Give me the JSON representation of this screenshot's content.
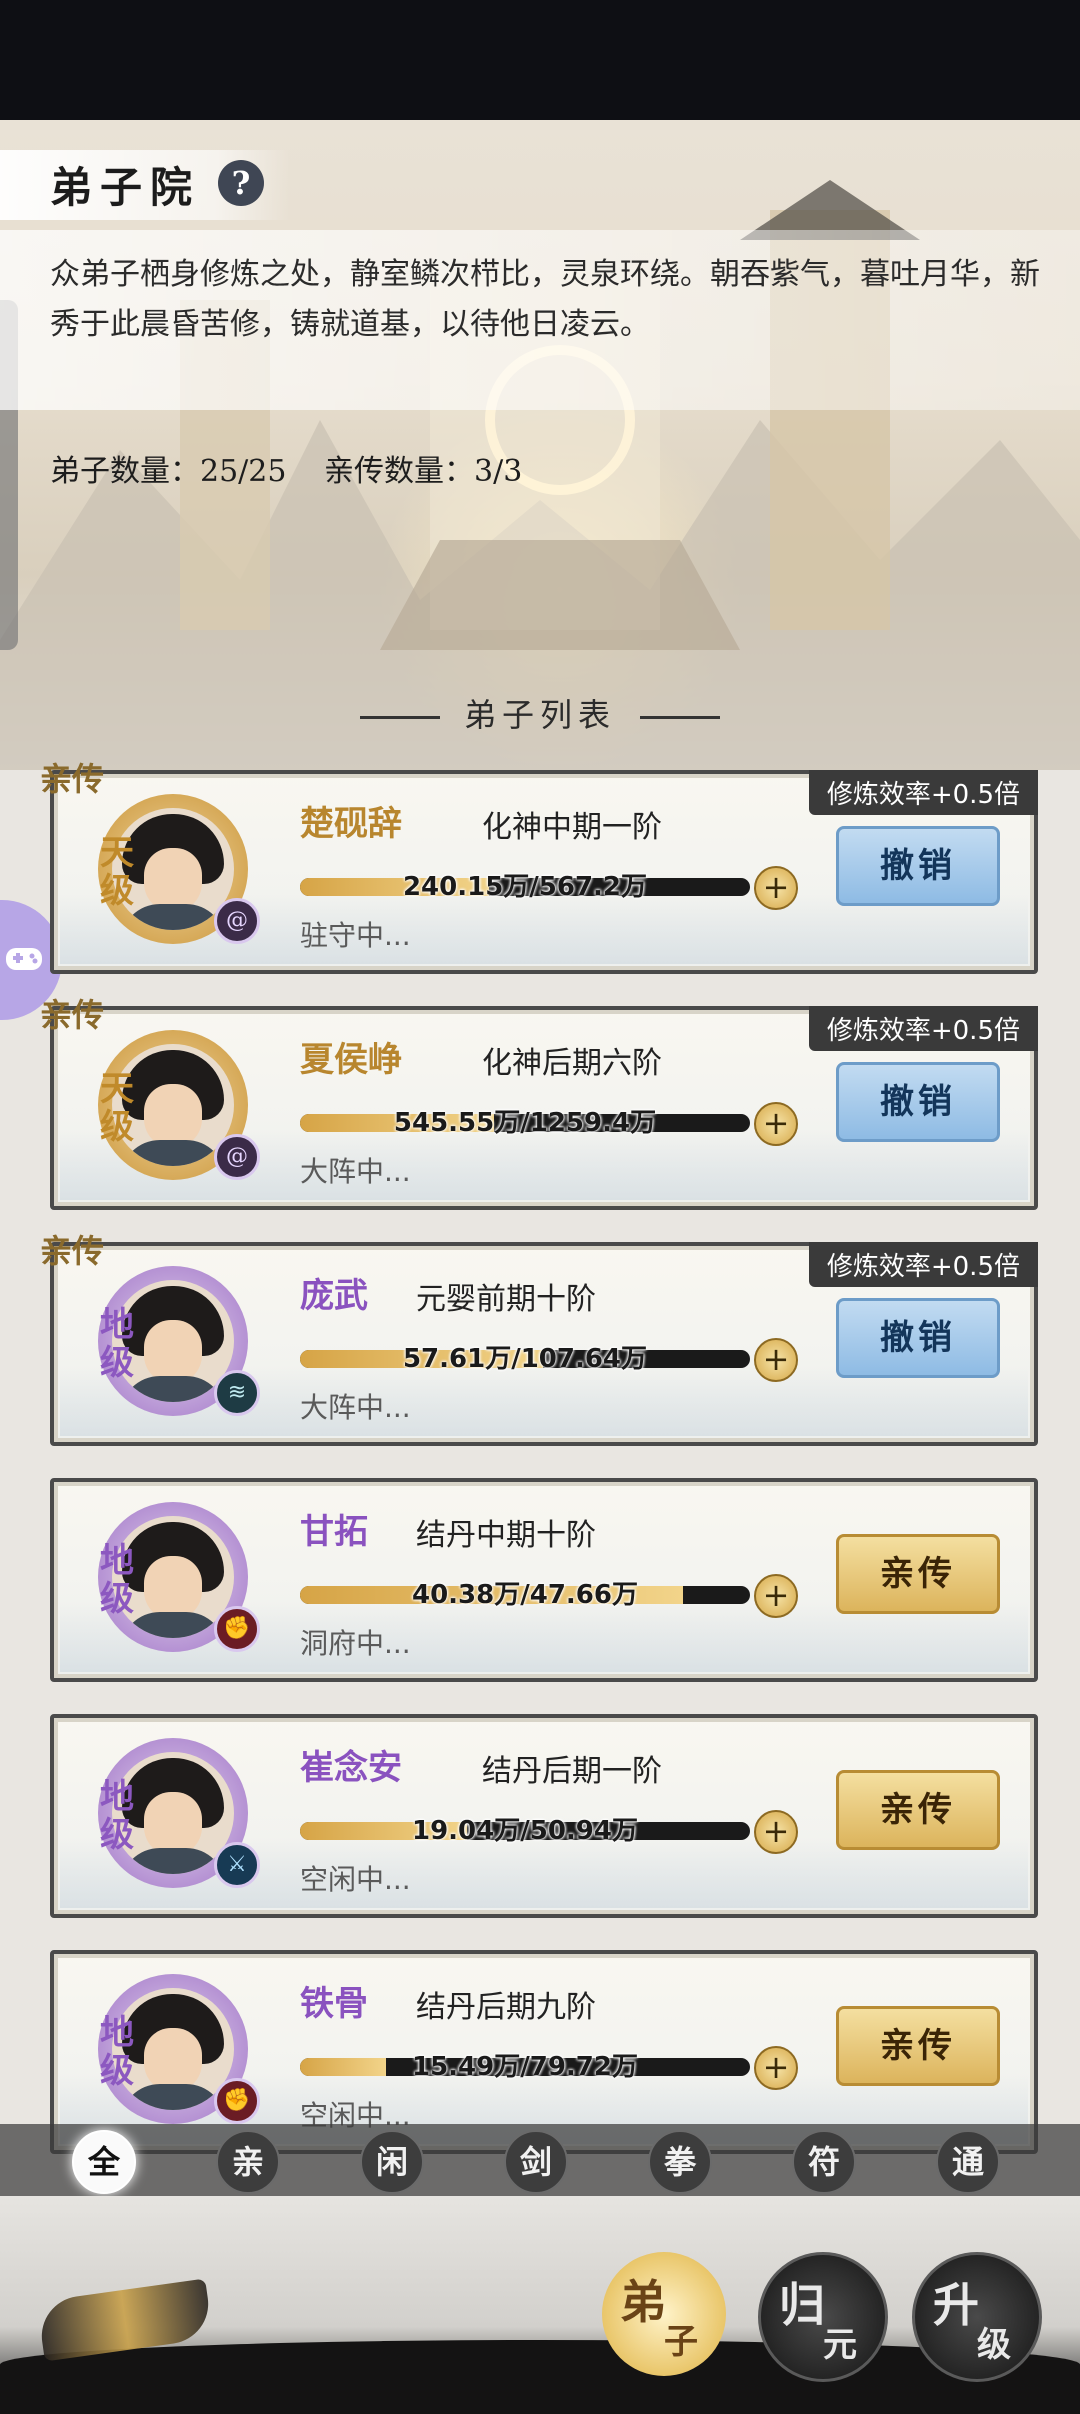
{
  "header": {
    "title": "弟子院",
    "help_icon": "question-icon",
    "help_text": "?",
    "description": "众弟子栖身修炼之处，静室鳞次栉比，灵泉环绕。朝吞紫气，暮吐月华，新秀于此晨昏苦修，铸就道基，以待他日凌云。",
    "disciple_count": "弟子数量：25/25",
    "direct_count": "亲传数量：3/3"
  },
  "list_title": "弟子列表",
  "cards": [
    {
      "tag": "亲传",
      "efficiency": "修炼效率+0.5倍",
      "name": "楚砚辞",
      "realm": "化神中期一阶",
      "rank": "天级",
      "rank_color": "#c08a2a",
      "element_icon": "spiral-icon",
      "progress": "240.15万/567.2万",
      "progress_frac": 0.42,
      "status": "驻守中...",
      "button": "撤销",
      "button_style": "blue"
    },
    {
      "tag": "亲传",
      "efficiency": "修炼效率+0.5倍",
      "name": "夏侯峥",
      "realm": "化神后期六阶",
      "rank": "天级",
      "rank_color": "#c08a2a",
      "element_icon": "spiral-icon",
      "progress": "545.55万/1259.4万",
      "progress_frac": 0.43,
      "status": "大阵中...",
      "button": "撤销",
      "button_style": "blue"
    },
    {
      "tag": "亲传",
      "efficiency": "修炼效率+0.5倍",
      "name": "庞武",
      "realm": "元婴前期十阶",
      "rank": "地级",
      "rank_color": "#8c58c0",
      "element_icon": "wind-icon",
      "progress": "57.61万/107.64万",
      "progress_frac": 0.54,
      "status": "大阵中...",
      "button": "撤销",
      "button_style": "blue"
    },
    {
      "tag": "",
      "efficiency": "",
      "name": "甘拓",
      "realm": "结丹中期十阶",
      "rank": "地级",
      "rank_color": "#8c58c0",
      "element_icon": "fist-icon",
      "progress": "40.38万/47.66万",
      "progress_frac": 0.85,
      "status": "洞府中...",
      "button": "亲传",
      "button_style": "gold"
    },
    {
      "tag": "",
      "efficiency": "",
      "name": "崔念安",
      "realm": "结丹后期一阶",
      "rank": "地级",
      "rank_color": "#8c58c0",
      "element_icon": "sword-icon",
      "progress": "19.04万/50.94万",
      "progress_frac": 0.37,
      "status": "空闲中...",
      "button": "亲传",
      "button_style": "gold"
    },
    {
      "tag": "",
      "efficiency": "",
      "name": "铁骨",
      "realm": "结丹后期九阶",
      "rank": "地级",
      "rank_color": "#8c58c0",
      "element_icon": "fist-icon",
      "progress": "15.49万/79.72万",
      "progress_frac": 0.19,
      "status": "空闲中...",
      "button": "亲传",
      "button_style": "gold"
    }
  ],
  "filters": [
    "全",
    "亲",
    "闲",
    "剑",
    "拳",
    "符",
    "通"
  ],
  "active_filter": "全",
  "bottom_nav": [
    {
      "l1": "弟",
      "l2": "子",
      "active": true
    },
    {
      "l1": "归",
      "l2": "元",
      "active": false
    },
    {
      "l1": "升",
      "l2": "级",
      "active": false
    }
  ]
}
